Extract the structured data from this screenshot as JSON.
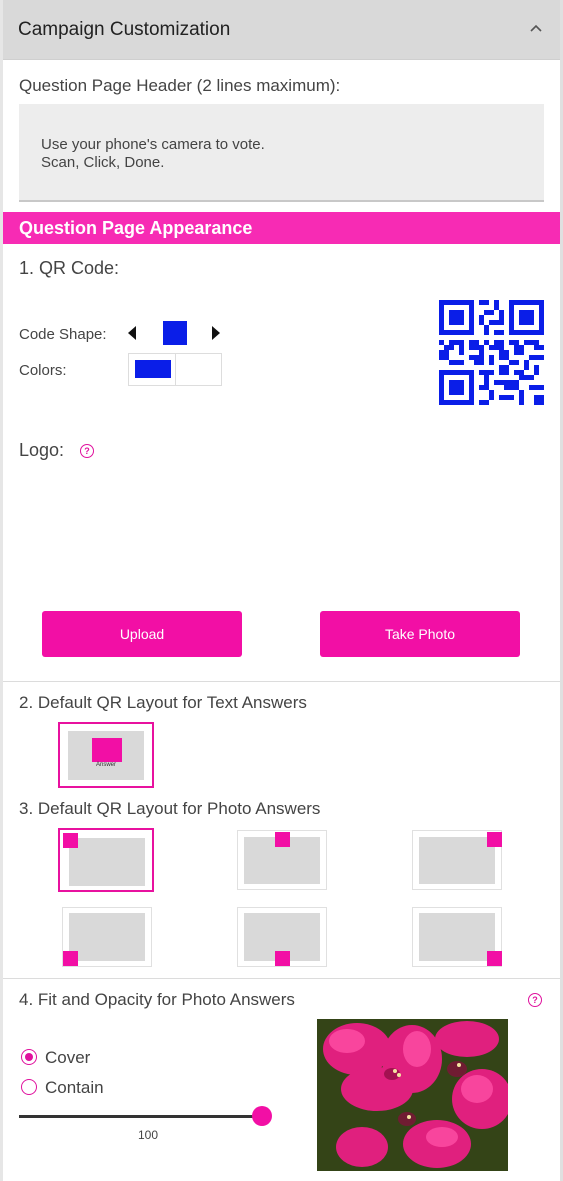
{
  "panel": {
    "title": "Campaign Customization"
  },
  "header_field": {
    "label": "Question Page Header (2 lines maximum):",
    "line1": "Use your phone's camera to vote.",
    "line2": "Scan, Click, Done."
  },
  "appearance": {
    "title": "Question Page Appearance"
  },
  "qr": {
    "heading": "1. QR Code:",
    "shape_label": "Code Shape:",
    "colors_label": "Colors:",
    "foreground_color": "#0a1ee8",
    "background_color": "#ffffff"
  },
  "logo": {
    "label": "Logo:",
    "upload_label": "Upload",
    "take_photo_label": "Take Photo"
  },
  "text_layout": {
    "heading": "2. Default QR Layout for Text Answers",
    "answer_label": "Answer"
  },
  "photo_layout": {
    "heading": "3. Default QR Layout for Photo Answers"
  },
  "fit": {
    "heading": "4. Fit and Opacity for Photo Answers",
    "cover_label": "Cover",
    "contain_label": "Contain",
    "selected": "Cover",
    "opacity": "100"
  },
  "colors": {
    "accent": "#f20fa5",
    "qr_blue": "#0a1ee8"
  }
}
